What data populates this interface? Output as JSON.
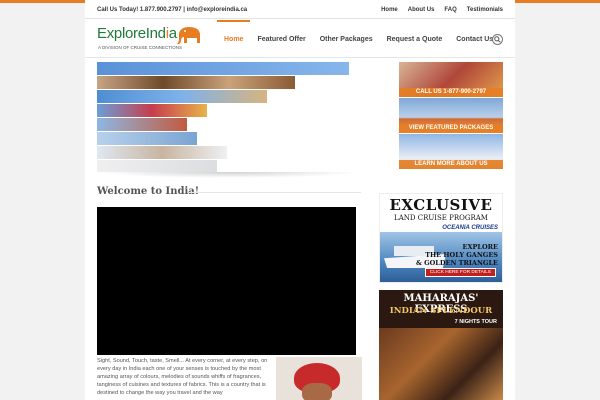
{
  "topbar": {
    "contact": "Call Us Today! 1.877.900.2797  |  info@exploreindia.ca",
    "links": [
      "Home",
      "About Us",
      "FAQ",
      "Testimonials"
    ]
  },
  "logo": {
    "name_part1": "Explore",
    "name_part2": "Ind",
    "name_o": "i",
    "name_part3": "a",
    "tagline": "A DIVISION OF CRUISE CONNECTIONS"
  },
  "nav": {
    "items": [
      "Home",
      "Featured Offer",
      "Other Packages",
      "Request a Quote",
      "Contact Us"
    ],
    "active": "Home"
  },
  "promos": [
    {
      "label": "CALL US 1-877-900-2797"
    },
    {
      "label": "VIEW FEATURED PACKAGES"
    },
    {
      "label": "LEARN MORE ABOUT US"
    }
  ],
  "main": {
    "title": "Welcome to India!",
    "body": "Sight, Sound, Touch, taste, Smell... At every corner, at every step, on every day in India each one of your senses is touched by the most amazing array of colours, melodies of sounds whiffs of fragrances, tanginess of cuisines and textures of fabrics. This is a country that is destined to change the way you travel and the way"
  },
  "ads": {
    "cruise": {
      "headline": "EXCLUSIVE",
      "subhead": "LAND CRUISE PROGRAM",
      "brand": "OCEANIA CRUISES",
      "explore": [
        "EXPLORE",
        "THE HOLY GANGES",
        "& GOLDEN TRIANGLE"
      ],
      "cta": "CLICK HERE FOR DETAILS"
    },
    "train": {
      "title": "MAHARAJAS' EXPRESS",
      "subtitle": "INDIAN SPLENDOUR",
      "tour": "7 NIGHTS TOUR"
    }
  },
  "colors": {
    "accent": "#e77d22",
    "brand_green": "#1f7a3a"
  }
}
